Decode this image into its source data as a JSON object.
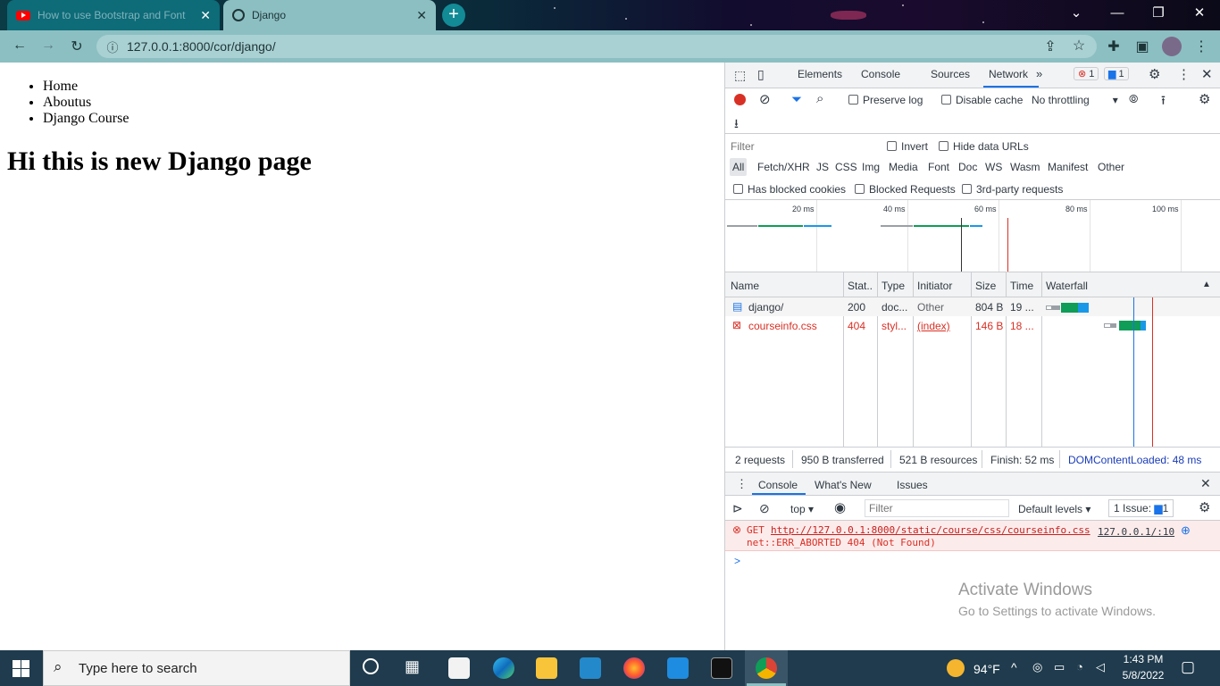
{
  "tabs": [
    {
      "title": "How to use Bootstrap and Font",
      "icon": "youtube-icon"
    },
    {
      "title": "Django",
      "icon": "globe-icon"
    }
  ],
  "toolbar": {
    "url": "127.0.0.1:8000/cor/django/"
  },
  "page": {
    "nav_items": [
      "Home",
      "Aboutus",
      "Django Course"
    ],
    "heading": "Hi this is new Django page"
  },
  "devtools": {
    "main_tabs": [
      "Elements",
      "Console",
      "Sources",
      "Network"
    ],
    "active_tab": "Network",
    "error_badge": "1",
    "issue_badge": "1",
    "preserve_log": "Preserve log",
    "disable_cache": "Disable cache",
    "throttling": "No throttling",
    "filter_placeholder": "Filter",
    "invert": "Invert",
    "hide_data_urls": "Hide data URLs",
    "type_filters": [
      "All",
      "Fetch/XHR",
      "JS",
      "CSS",
      "Img",
      "Media",
      "Font",
      "Doc",
      "WS",
      "Wasm",
      "Manifest",
      "Other"
    ],
    "has_blocked_cookies": "Has blocked cookies",
    "blocked_requests": "Blocked Requests",
    "third_party": "3rd-party requests",
    "timeline_ticks": [
      "20 ms",
      "40 ms",
      "60 ms",
      "80 ms",
      "100 ms"
    ],
    "columns": [
      "Name",
      "Stat..",
      "Type",
      "Initiator",
      "Size",
      "Time",
      "Waterfall"
    ],
    "rows": [
      {
        "name": "django/",
        "status": "200",
        "type": "doc...",
        "initiator": "Other",
        "size": "804 B",
        "time": "19 ..."
      },
      {
        "name": "courseinfo.css",
        "status": "404",
        "type": "styl...",
        "initiator": "(index)",
        "size": "146 B",
        "time": "18 ..."
      }
    ],
    "summary": {
      "requests": "2 requests",
      "transferred": "950 B transferred",
      "resources": "521 B resources",
      "finish": "Finish: 52 ms",
      "dcl": "DOMContentLoaded: 48 ms"
    },
    "drawer_tabs": [
      "Console",
      "What's New",
      "Issues"
    ],
    "console_context": "top",
    "console_filter": "Filter",
    "default_levels": "Default levels",
    "issue_count": "1 Issue:",
    "issue_num": "1",
    "error_line1": "GET",
    "error_url": "http://127.0.0.1:8000/static/course/css/courseinfo.css",
    "error_line2": "net::ERR_ABORTED 404 (Not Found)",
    "error_source": "127.0.0.1/:10",
    "prompt": ">"
  },
  "watermark": {
    "title": "Activate Windows",
    "subtitle": "Go to Settings to activate Windows."
  },
  "taskbar": {
    "search_placeholder": "Type here to search",
    "weather": "94°F",
    "time": "1:43 PM",
    "date": "5/8/2022"
  },
  "colors": {
    "error": "#d93025",
    "accent": "#1a73e8",
    "chrome_frame": "#8cbfc2"
  }
}
